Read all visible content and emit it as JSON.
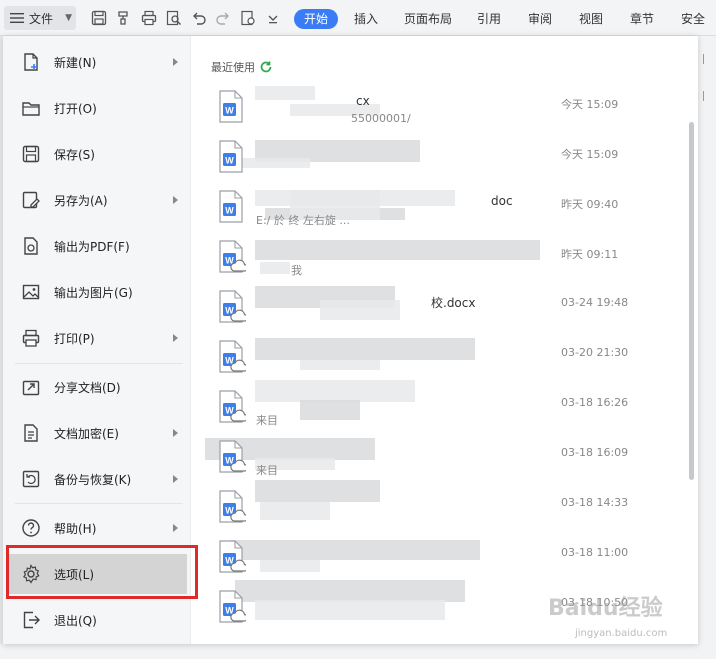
{
  "toolbar": {
    "menu_label": "文件",
    "tabs": [
      {
        "label": "开始",
        "active": true
      },
      {
        "label": "插入"
      },
      {
        "label": "页面布局"
      },
      {
        "label": "引用"
      },
      {
        "label": "审阅"
      },
      {
        "label": "视图"
      },
      {
        "label": "章节"
      },
      {
        "label": "安全"
      }
    ],
    "accent_color": "#3a7cf5"
  },
  "menu": {
    "items": [
      {
        "label": "新建(N)",
        "icon": "new-doc-icon",
        "submenu": true
      },
      {
        "label": "打开(O)",
        "icon": "folder-icon",
        "submenu": false
      },
      {
        "label": "保存(S)",
        "icon": "save-icon",
        "submenu": false
      },
      {
        "label": "另存为(A)",
        "icon": "save-as-icon",
        "submenu": true
      },
      {
        "label": "输出为PDF(F)",
        "icon": "pdf-export-icon",
        "submenu": false
      },
      {
        "label": "输出为图片(G)",
        "icon": "image-export-icon",
        "submenu": false
      },
      {
        "label": "打印(P)",
        "icon": "print-icon",
        "submenu": true
      },
      {
        "label": "分享文档(D)",
        "icon": "share-icon",
        "submenu": false
      },
      {
        "label": "文档加密(E)",
        "icon": "encrypt-icon",
        "submenu": true
      },
      {
        "label": "备份与恢复(K)",
        "icon": "backup-icon",
        "submenu": true
      },
      {
        "label": "帮助(H)",
        "icon": "help-icon",
        "submenu": true
      },
      {
        "label": "选项(L)",
        "icon": "gear-icon",
        "submenu": false,
        "highlighted": true
      },
      {
        "label": "退出(Q)",
        "icon": "exit-icon",
        "submenu": false
      }
    ],
    "highlight_color": "#e02a2a"
  },
  "recent": {
    "title": "最近使用",
    "files": [
      {
        "name": "cx",
        "path": "55000001/",
        "time": "今天 15:09",
        "cloud": false
      },
      {
        "name": "",
        "path": "",
        "time": "今天 15:09",
        "cloud": false
      },
      {
        "name": "doc",
        "path": "E:/ 於  终 左右旋 ...",
        "time": "昨天 09:40",
        "cloud": false
      },
      {
        "name": "",
        "path": "我",
        "time": "昨天 09:11",
        "cloud": true
      },
      {
        "name": "校.docx",
        "path": "",
        "time": "03-24 19:48",
        "cloud": true
      },
      {
        "name": "",
        "path": "",
        "time": "03-20 21:30",
        "cloud": true
      },
      {
        "name": "",
        "path": "来目",
        "time": "03-18 16:26",
        "cloud": true
      },
      {
        "name": "",
        "path": "来目",
        "time": "03-18 16:09",
        "cloud": true
      },
      {
        "name": "",
        "path": "",
        "time": "03-18 14:33",
        "cloud": true
      },
      {
        "name": "",
        "path": "",
        "time": "03-18 11:00",
        "cloud": true
      },
      {
        "name": "",
        "path": "",
        "time": "03-18 10:50",
        "cloud": true
      }
    ]
  },
  "watermark": {
    "logo": "Baidu经验",
    "url": "jingyan.baidu.com"
  }
}
